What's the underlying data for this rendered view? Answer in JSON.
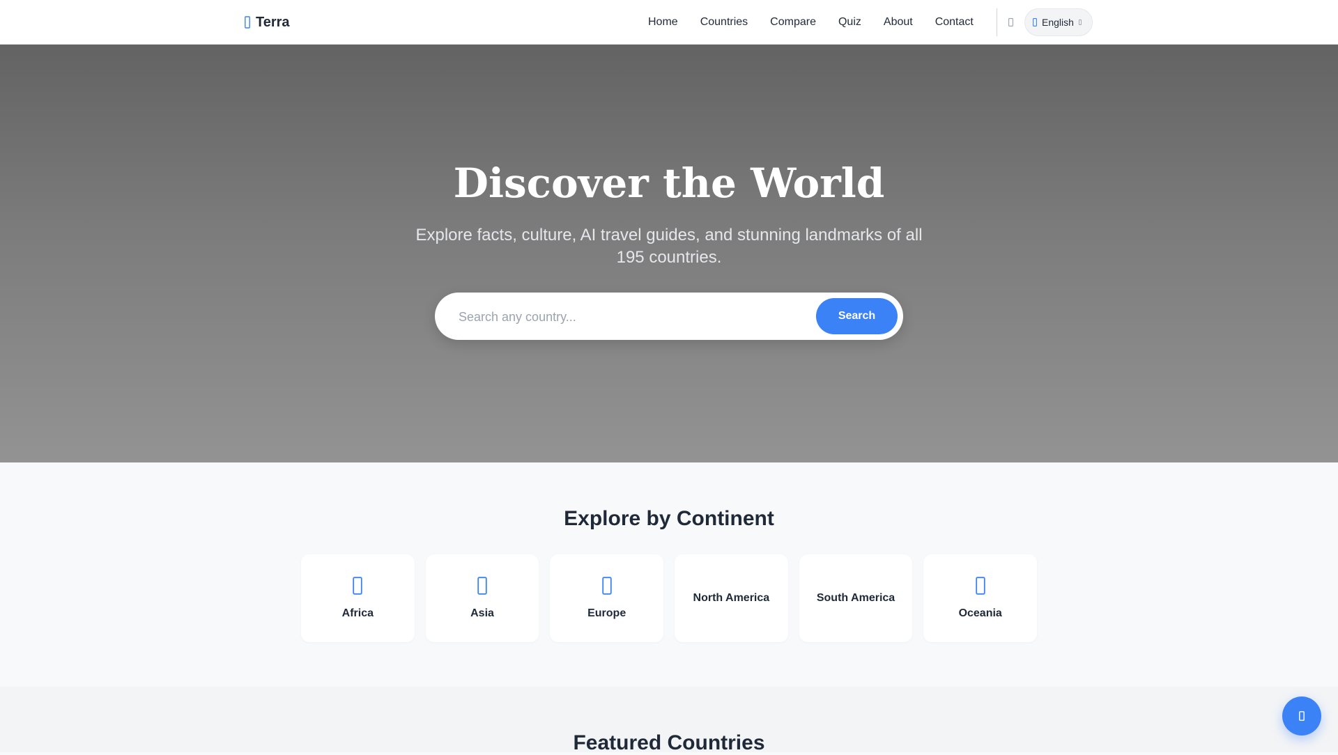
{
  "colors": {
    "accent": "#3b82f6",
    "text_dark": "#1f2937",
    "hero_top": "#636363",
    "hero_bottom": "#939393"
  },
  "navbar": {
    "brand": {
      "name": "Terra",
      "icon": "globe-icon"
    },
    "links": [
      {
        "label": "Home"
      },
      {
        "label": "Countries"
      },
      {
        "label": "Compare"
      },
      {
        "label": "Quiz"
      },
      {
        "label": "About"
      },
      {
        "label": "Contact"
      }
    ],
    "theme_toggle_icon": "moon-icon",
    "language": {
      "label": "English",
      "icon": "globe-icon",
      "caret_icon": "chevron-down-icon"
    }
  },
  "hero": {
    "title": "Discover the World",
    "subtitle": "Explore facts, culture, AI travel guides, and stunning landmarks of all 195 countries.",
    "search": {
      "placeholder": "Search any country...",
      "value": "",
      "button_label": "Search"
    }
  },
  "continents": {
    "title": "Explore by Continent",
    "items": [
      {
        "label": "Africa",
        "icon": "globe-icon"
      },
      {
        "label": "Asia",
        "icon": "globe-icon"
      },
      {
        "label": "Europe",
        "icon": "globe-icon"
      },
      {
        "label": "North America",
        "icon": ""
      },
      {
        "label": "South America",
        "icon": ""
      },
      {
        "label": "Oceania",
        "icon": "globe-icon"
      }
    ]
  },
  "featured": {
    "title": "Featured Countries"
  },
  "fab": {
    "icon": "chat-icon"
  }
}
